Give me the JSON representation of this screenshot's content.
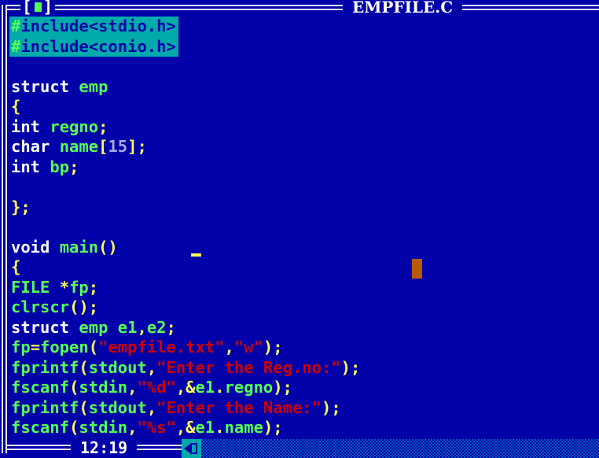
{
  "window": {
    "title": "EMPFILE.C",
    "close_box": {
      "left": "[",
      "right": "]",
      "icon": "close-square-icon"
    },
    "status": {
      "cursor_position": "12:19"
    }
  },
  "editor": {
    "lines": [
      {
        "selected": true,
        "tokens": [
          {
            "t": "#",
            "c": "hash"
          },
          {
            "t": "include<stdio.h>",
            "c": "plain"
          }
        ]
      },
      {
        "selected": true,
        "tokens": [
          {
            "t": "#",
            "c": "hash"
          },
          {
            "t": "include<conio.h>",
            "c": "plain"
          }
        ]
      },
      {
        "tokens": []
      },
      {
        "tokens": [
          {
            "t": "struct",
            "c": "kw"
          },
          {
            "t": " ",
            "c": "kw"
          },
          {
            "t": "emp",
            "c": "id"
          }
        ]
      },
      {
        "tokens": [
          {
            "t": "{",
            "c": "pn"
          }
        ]
      },
      {
        "tokens": [
          {
            "t": "int",
            "c": "kw"
          },
          {
            "t": " ",
            "c": "kw"
          },
          {
            "t": "regno",
            "c": "id"
          },
          {
            "t": ";",
            "c": "pn"
          }
        ]
      },
      {
        "tokens": [
          {
            "t": "char",
            "c": "kw"
          },
          {
            "t": " ",
            "c": "kw"
          },
          {
            "t": "name",
            "c": "id"
          },
          {
            "t": "[",
            "c": "pn"
          },
          {
            "t": "15",
            "c": "num"
          },
          {
            "t": "];",
            "c": "pn"
          }
        ]
      },
      {
        "tokens": [
          {
            "t": "int",
            "c": "kw"
          },
          {
            "t": " ",
            "c": "kw"
          },
          {
            "t": "bp",
            "c": "id"
          },
          {
            "t": ";",
            "c": "pn"
          }
        ]
      },
      {
        "tokens": []
      },
      {
        "tokens": [
          {
            "t": "};",
            "c": "pn"
          }
        ]
      },
      {
        "tokens": []
      },
      {
        "tokens": [
          {
            "t": "void",
            "c": "kw"
          },
          {
            "t": " ",
            "c": "kw"
          },
          {
            "t": "main",
            "c": "id"
          },
          {
            "t": "()",
            "c": "pn"
          }
        ]
      },
      {
        "tokens": [
          {
            "t": "{",
            "c": "pn"
          }
        ]
      },
      {
        "tokens": [
          {
            "t": "FILE",
            "c": "id"
          },
          {
            "t": " ",
            "c": "kw"
          },
          {
            "t": "*",
            "c": "pn"
          },
          {
            "t": "fp",
            "c": "id"
          },
          {
            "t": ";",
            "c": "pn"
          }
        ]
      },
      {
        "tokens": [
          {
            "t": "clrscr",
            "c": "id"
          },
          {
            "t": "();",
            "c": "pn"
          }
        ]
      },
      {
        "tokens": [
          {
            "t": "struct",
            "c": "kw"
          },
          {
            "t": " ",
            "c": "kw"
          },
          {
            "t": "emp",
            "c": "id"
          },
          {
            "t": " ",
            "c": "kw"
          },
          {
            "t": "e1",
            "c": "id"
          },
          {
            "t": ",",
            "c": "pn"
          },
          {
            "t": "e2",
            "c": "id"
          },
          {
            "t": ";",
            "c": "pn"
          }
        ]
      },
      {
        "tokens": [
          {
            "t": "fp",
            "c": "id"
          },
          {
            "t": "=",
            "c": "pn"
          },
          {
            "t": "fopen",
            "c": "id"
          },
          {
            "t": "(",
            "c": "pn"
          },
          {
            "t": "\"empfile.txt\"",
            "c": "str"
          },
          {
            "t": ",",
            "c": "pn"
          },
          {
            "t": "\"w\"",
            "c": "str"
          },
          {
            "t": ");",
            "c": "pn"
          }
        ]
      },
      {
        "tokens": [
          {
            "t": "fprintf",
            "c": "id"
          },
          {
            "t": "(",
            "c": "pn"
          },
          {
            "t": "stdout",
            "c": "id"
          },
          {
            "t": ",",
            "c": "pn"
          },
          {
            "t": "\"Enter the Reg.no:\"",
            "c": "str"
          },
          {
            "t": ");",
            "c": "pn"
          }
        ]
      },
      {
        "tokens": [
          {
            "t": "fscanf",
            "c": "id"
          },
          {
            "t": "(",
            "c": "pn"
          },
          {
            "t": "stdin",
            "c": "id"
          },
          {
            "t": ",",
            "c": "pn"
          },
          {
            "t": "\"%d\"",
            "c": "str"
          },
          {
            "t": ",&",
            "c": "pn"
          },
          {
            "t": "e1",
            "c": "id"
          },
          {
            "t": ".",
            "c": "pn"
          },
          {
            "t": "regno",
            "c": "id"
          },
          {
            "t": ");",
            "c": "pn"
          }
        ]
      },
      {
        "tokens": [
          {
            "t": "fprintf",
            "c": "id"
          },
          {
            "t": "(",
            "c": "pn"
          },
          {
            "t": "stdout",
            "c": "id"
          },
          {
            "t": ",",
            "c": "pn"
          },
          {
            "t": "\"Enter the Name:\"",
            "c": "str"
          },
          {
            "t": ");",
            "c": "pn"
          }
        ]
      },
      {
        "tokens": [
          {
            "t": "fscanf",
            "c": "id"
          },
          {
            "t": "(",
            "c": "pn"
          },
          {
            "t": "stdin",
            "c": "id"
          },
          {
            "t": ",",
            "c": "pn"
          },
          {
            "t": "\"%s\"",
            "c": "str"
          },
          {
            "t": ",&",
            "c": "pn"
          },
          {
            "t": "e1",
            "c": "id"
          },
          {
            "t": ".",
            "c": "pn"
          },
          {
            "t": "name",
            "c": "id"
          },
          {
            "t": ");",
            "c": "pn"
          }
        ]
      }
    ]
  },
  "scrollbar": {
    "left_arrow_icon": "arrow-left-icon",
    "thumb_icon": "scroll-thumb-icon"
  },
  "colors": {
    "background": "#0000a8",
    "selection": "#00aaaa",
    "keyword": "#ffffff",
    "identifier": "#55ff55",
    "punctuation": "#ffff55",
    "number": "#a8a8d8",
    "string": "#d00000",
    "mouse_cursor": "#b85a00"
  }
}
